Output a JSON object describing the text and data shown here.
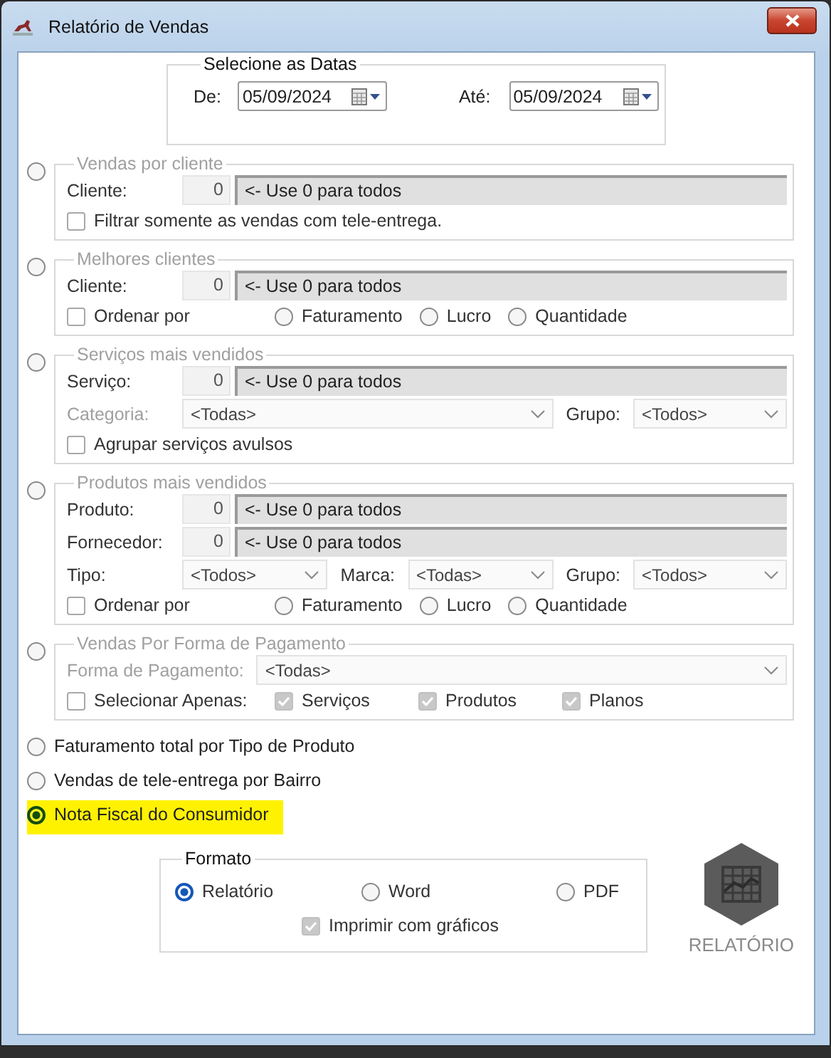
{
  "window": {
    "title": "Relatório de Vendas"
  },
  "dates": {
    "legend": "Selecione as Datas",
    "fields": [
      {
        "label": "De:",
        "value": "05/09/2024"
      },
      {
        "label": "Até:",
        "value": "05/09/2024"
      }
    ]
  },
  "reports": [
    {
      "kind": "group",
      "label": "Vendas por cliente",
      "selected": false,
      "rows": [
        {
          "kind": "code",
          "label": "Cliente:",
          "value": "0",
          "hint": "<- Use 0 para todos"
        },
        {
          "kind": "check",
          "label": "Filtrar somente as vendas com tele-entrega.",
          "checked": false,
          "disabled": false
        }
      ]
    },
    {
      "kind": "group",
      "label": "Melhores clientes",
      "selected": false,
      "rows": [
        {
          "kind": "code",
          "label": "Cliente:",
          "value": "0",
          "hint": "<- Use 0 para todos"
        },
        {
          "kind": "sort",
          "check": {
            "label": "Ordenar por",
            "checked": false,
            "disabled": false
          },
          "options": [
            {
              "label": "Faturamento",
              "selected": false
            },
            {
              "label": "Lucro",
              "selected": false
            },
            {
              "label": "Quantidade",
              "selected": false
            }
          ]
        }
      ]
    },
    {
      "kind": "group",
      "label": "Serviços mais vendidos",
      "selected": false,
      "rows": [
        {
          "kind": "code",
          "label": "Serviço:",
          "value": "0",
          "hint": "<- Use 0 para todos"
        },
        {
          "kind": "combos",
          "items": [
            {
              "label": "Categoria:",
              "disabled": true,
              "value": "<Todas>"
            },
            {
              "label": "Grupo:",
              "disabled": false,
              "value": "<Todos>"
            }
          ]
        },
        {
          "kind": "check",
          "label": "Agrupar serviços avulsos",
          "checked": false,
          "disabled": false
        }
      ]
    },
    {
      "kind": "group",
      "label": "Produtos mais vendidos",
      "selected": false,
      "rows": [
        {
          "kind": "code",
          "label": "Produto:",
          "value": "0",
          "hint": "<- Use 0 para todos"
        },
        {
          "kind": "code",
          "label": "Fornecedor:",
          "value": "0",
          "hint": "<- Use 0 para todos"
        },
        {
          "kind": "combos",
          "items": [
            {
              "label": "Tipo:",
              "disabled": false,
              "value": "<Todos>"
            },
            {
              "label": "Marca:",
              "disabled": false,
              "value": "<Todas>"
            },
            {
              "label": "Grupo:",
              "disabled": false,
              "value": "<Todos>"
            }
          ]
        },
        {
          "kind": "sort",
          "check": {
            "label": "Ordenar por",
            "checked": false,
            "disabled": false
          },
          "options": [
            {
              "label": "Faturamento",
              "selected": false
            },
            {
              "label": "Lucro",
              "selected": false
            },
            {
              "label": "Quantidade",
              "selected": false
            }
          ]
        }
      ]
    },
    {
      "kind": "group",
      "label": "Vendas Por Forma de Pagamento",
      "selected": false,
      "rows": [
        {
          "kind": "combos",
          "items": [
            {
              "label": "Forma de Pagamento:",
              "disabled": true,
              "value": "<Todas>"
            }
          ]
        },
        {
          "kind": "filter",
          "check": {
            "label": "Selecionar Apenas:",
            "checked": false,
            "disabled": false
          },
          "options": [
            {
              "label": "Serviços",
              "checked": true,
              "disabled": true
            },
            {
              "label": "Produtos",
              "checked": true,
              "disabled": true
            },
            {
              "label": "Planos",
              "checked": true,
              "disabled": true
            }
          ]
        }
      ]
    },
    {
      "kind": "plain",
      "label": "Faturamento total por Tipo de Produto",
      "selected": false
    },
    {
      "kind": "plain",
      "label": "Vendas de tele-entrega por Bairro",
      "selected": false
    },
    {
      "kind": "plain",
      "label": "Nota Fiscal do Consumidor",
      "selected": true
    }
  ],
  "format": {
    "legend": "Formato",
    "options": [
      {
        "label": "Relatório",
        "selected": true
      },
      {
        "label": "Word",
        "selected": false
      },
      {
        "label": "PDF",
        "selected": false
      }
    ],
    "graphs": {
      "label": "Imprimir com gráficos",
      "checked": true,
      "disabled": true
    }
  },
  "action": {
    "label": "RELATÓRIO"
  }
}
